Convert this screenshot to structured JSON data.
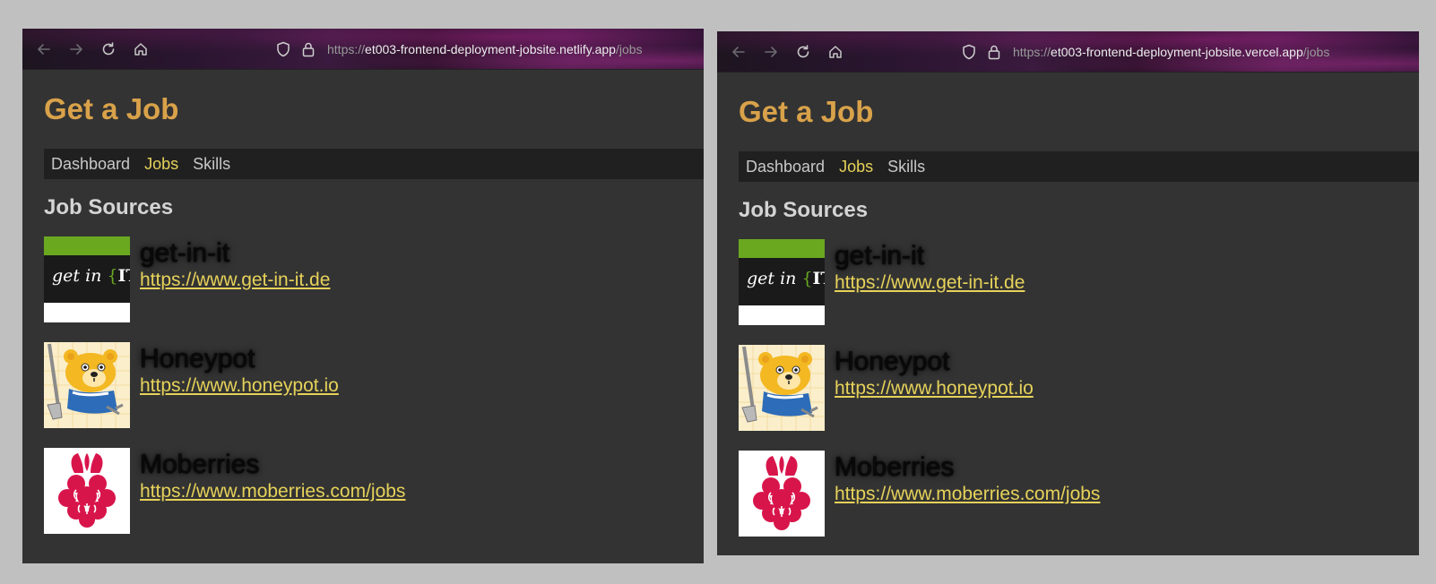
{
  "windows": [
    {
      "id": "left",
      "url": {
        "scheme": "https://",
        "host": "et003-frontend-deployment-jobsite.netlify.app",
        "path": "/jobs"
      }
    },
    {
      "id": "right",
      "url": {
        "scheme": "https://",
        "host": "et003-frontend-deployment-jobsite.vercel.app",
        "path": "/jobs"
      }
    }
  ],
  "browser": {
    "back_icon": "back-arrow-icon",
    "forward_icon": "forward-arrow-icon",
    "reload_icon": "reload-icon",
    "home_icon": "home-icon",
    "shield_icon": "shield-icon",
    "lock_icon": "lock-icon"
  },
  "app": {
    "brand": "Get a Job",
    "nav": [
      {
        "label": "Dashboard",
        "active": false
      },
      {
        "label": "Jobs",
        "active": true
      },
      {
        "label": "Skills",
        "active": false
      }
    ],
    "section_title": "Job Sources",
    "sources": [
      {
        "name": "get-in-it",
        "url": "https://www.get-in-it.de",
        "logo": "get-in-it-logo",
        "logo_text": "get in {IT}"
      },
      {
        "name": "Honeypot",
        "url": "https://www.honeypot.io",
        "logo": "honeypot-bear-logo"
      },
      {
        "name": "Moberries",
        "url": "https://www.moberries.com/jobs",
        "logo": "moberries-raspberry-logo"
      }
    ]
  },
  "colors": {
    "brand": "#d9a24a",
    "link": "#e6d25a",
    "nav_active": "#e6d25a",
    "page_bg": "#333333",
    "navbar_bg": "#202020",
    "outer_bg": "#c0c0c0"
  }
}
